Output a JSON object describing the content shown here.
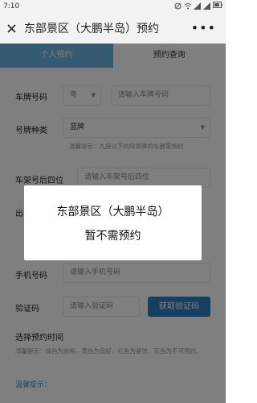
{
  "status": {
    "time": "7:10",
    "battery": ""
  },
  "nav": {
    "title": "东部景区（大鹏半岛）预约",
    "more": "•••"
  },
  "tabs": [
    {
      "label": "个人预约",
      "active": true
    },
    {
      "label": "预约查询",
      "active": false
    }
  ],
  "form": {
    "plate": {
      "label": "车牌号码",
      "province": "粤",
      "placeholder": "请输入车牌号码"
    },
    "plate_type": {
      "label": "号牌种类",
      "value": "蓝牌",
      "hint": "温馨提示：九座以下的除黄牌的车都需预约"
    },
    "vin": {
      "label": "车架号后四位",
      "placeholder": "请输入车架号后四位"
    },
    "departure": {
      "label": "出"
    },
    "phone": {
      "label": "手机号码",
      "placeholder": "请输入手机号码"
    },
    "code": {
      "label": "验证码",
      "placeholder": "请输入验证码",
      "button": "获取验证码"
    },
    "time_section": {
      "title": "选择预约时间",
      "hint": "温馨提示：绿色为充裕，黄色为良好，红色为紧张，灰色为不可预约。"
    },
    "warm_tip": "温馨提示："
  },
  "modal": {
    "line1": "东部景区（大鹏半岛）",
    "line2": "暂不需预约"
  }
}
